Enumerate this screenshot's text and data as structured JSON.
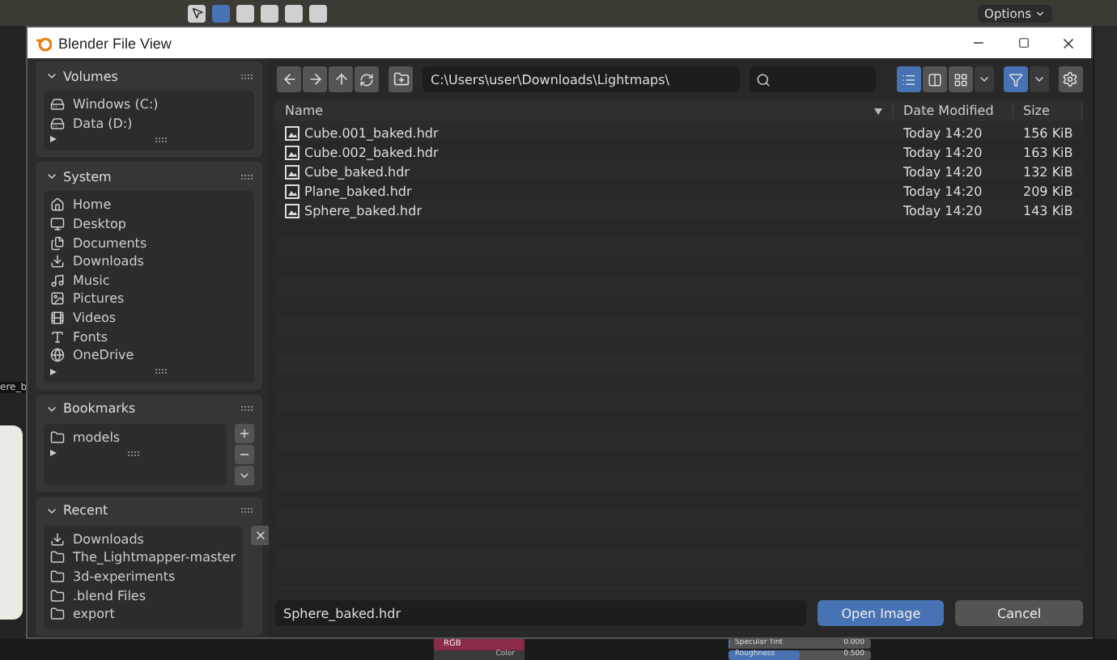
{
  "background": {
    "options_button": "Options",
    "left_label": "ere_b",
    "node_header": "RGB",
    "node_socket": "Color",
    "sliders": [
      {
        "label": "Specular Tint",
        "value": "0.000",
        "level": 0
      },
      {
        "label": "Roughness",
        "value": "0.500",
        "level": 0.5
      }
    ]
  },
  "window": {
    "title": "Blender File View"
  },
  "sidebar": {
    "panels": [
      {
        "title": "Volumes",
        "kind": "list",
        "expanded": true,
        "items": [
          {
            "label": "Windows (C:)",
            "kind": "drive"
          },
          {
            "label": "Data (D:)",
            "kind": "drive"
          }
        ]
      },
      {
        "title": "System",
        "kind": "list",
        "expanded": true,
        "items": [
          {
            "label": "Home",
            "kind": "home"
          },
          {
            "label": "Desktop",
            "kind": "desktop"
          },
          {
            "label": "Documents",
            "kind": "documents"
          },
          {
            "label": "Downloads",
            "kind": "download"
          },
          {
            "label": "Music",
            "kind": "music"
          },
          {
            "label": "Pictures",
            "kind": "image"
          },
          {
            "label": "Videos",
            "kind": "video"
          },
          {
            "label": "Fonts",
            "kind": "font"
          },
          {
            "label": "OneDrive",
            "kind": "globe"
          }
        ]
      },
      {
        "title": "Bookmarks",
        "kind": "bookmarks",
        "expanded": true,
        "items": [
          {
            "label": "models",
            "kind": "folder"
          }
        ]
      },
      {
        "title": "Recent",
        "kind": "recent",
        "expanded": true,
        "items": [
          {
            "label": "Downloads",
            "kind": "download"
          },
          {
            "label": "The_Lightmapper-master",
            "kind": "folder"
          },
          {
            "label": "3d-experiments",
            "kind": "folder"
          },
          {
            "label": ".blend Files",
            "kind": "folder"
          },
          {
            "label": "export",
            "kind": "folder"
          }
        ]
      }
    ]
  },
  "toolbar": {
    "path": "C:\\Users\\user\\Downloads\\Lightmaps\\",
    "view_modes": [
      {
        "kind": "list",
        "selected": true
      },
      {
        "kind": "columns",
        "selected": false
      },
      {
        "kind": "grid",
        "selected": false
      }
    ],
    "filter": {
      "on": true
    }
  },
  "table": {
    "columns": [
      {
        "label": "Name",
        "sorted": true
      },
      {
        "label": "Date Modified",
        "sorted": false
      },
      {
        "label": "Size",
        "sorted": false
      }
    ],
    "rows": [
      {
        "name": "Cube.001_baked.hdr",
        "date": "Today 14:20",
        "size": "156 KiB"
      },
      {
        "name": "Cube.002_baked.hdr",
        "date": "Today 14:20",
        "size": "163 KiB"
      },
      {
        "name": "Cube_baked.hdr",
        "date": "Today 14:20",
        "size": "132 KiB"
      },
      {
        "name": "Plane_baked.hdr",
        "date": "Today 14:20",
        "size": "209 KiB"
      },
      {
        "name": "Sphere_baked.hdr",
        "date": "Today 14:20",
        "size": "143 KiB"
      }
    ]
  },
  "footer": {
    "filename": "Sphere_baked.hdr",
    "buttons": [
      {
        "label": "Open Image",
        "kind": "primary"
      },
      {
        "label": "Cancel",
        "kind": "secondary"
      }
    ]
  }
}
